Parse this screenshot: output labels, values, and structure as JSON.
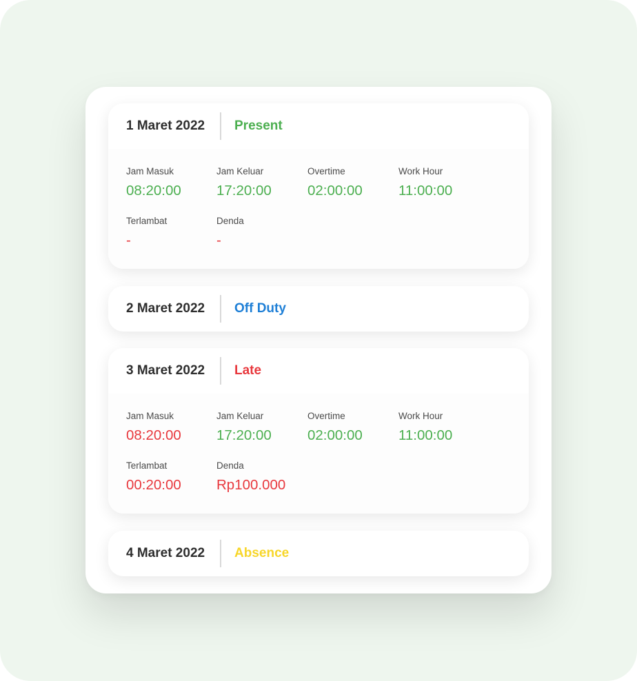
{
  "labels": {
    "jam_masuk": "Jam Masuk",
    "jam_keluar": "Jam Keluar",
    "overtime": "Overtime",
    "work_hour": "Work Hour",
    "terlambat": "Terlambat",
    "denda": "Denda"
  },
  "colors": {
    "present": "#4caf50",
    "off_duty": "#1e7fd6",
    "late": "#e8383d",
    "absence": "#f7d629"
  },
  "records": [
    {
      "date": "1 Maret 2022",
      "status": "Present",
      "jam_masuk": "08:20:00",
      "jam_keluar": "17:20:00",
      "overtime": "02:00:00",
      "work_hour": "11:00:00",
      "terlambat": "-",
      "denda": "-"
    },
    {
      "date": "2 Maret 2022",
      "status": "Off Duty"
    },
    {
      "date": "3 Maret 2022",
      "status": "Late",
      "jam_masuk": "08:20:00",
      "jam_keluar": "17:20:00",
      "overtime": "02:00:00",
      "work_hour": "11:00:00",
      "terlambat": "00:20:00",
      "denda": "Rp100.000"
    },
    {
      "date": "4 Maret 2022",
      "status": "Absence"
    }
  ]
}
